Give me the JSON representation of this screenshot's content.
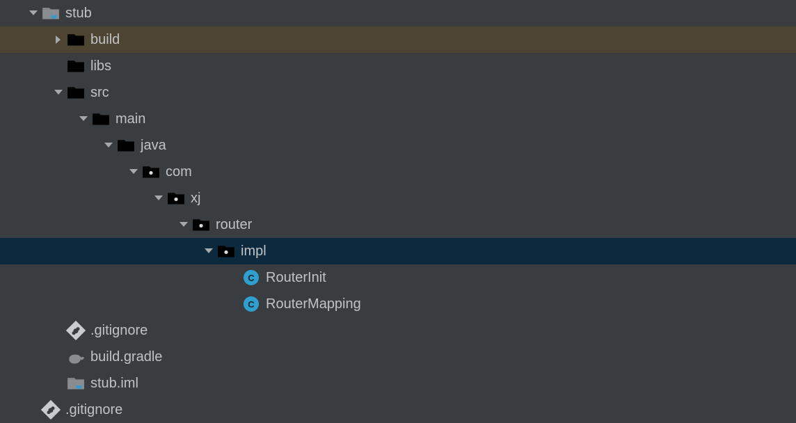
{
  "tree": {
    "stub": "stub",
    "build": "build",
    "libs": "libs",
    "src": "src",
    "main": "main",
    "java": "java",
    "com": "com",
    "xj": "xj",
    "router": "router",
    "impl": "impl",
    "routerInit": "RouterInit",
    "routerMapping": "RouterMapping",
    "gitignore": ".gitignore",
    "buildGradle": "build.gradle",
    "stubIml": "stub.iml",
    "rootGitignore": ".gitignore"
  },
  "icons": {
    "classLetter": "C"
  }
}
